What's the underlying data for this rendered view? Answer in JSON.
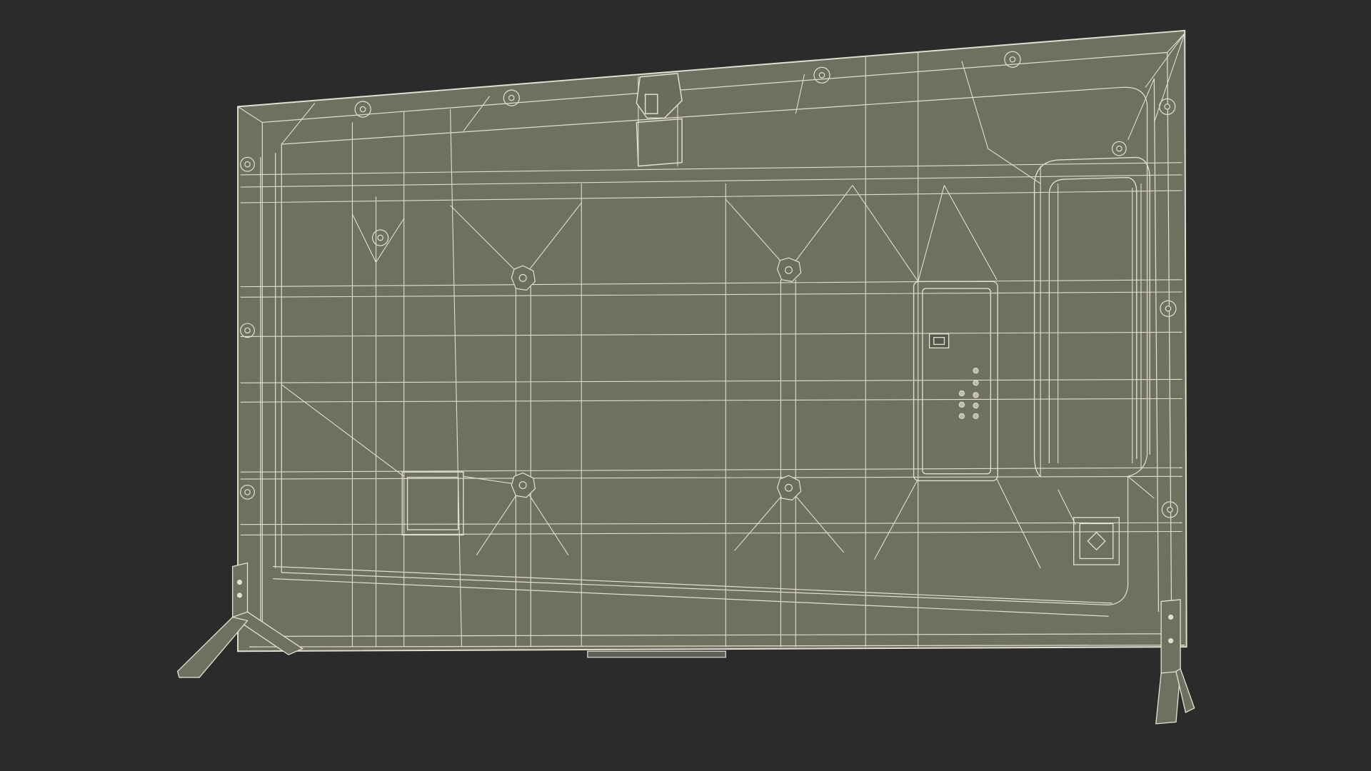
{
  "scene": {
    "subject": "tv-back-wireframe",
    "background_color": "#2b2b2b",
    "panel_fill": "#6e7060",
    "panel_fill_dark": "#63655a",
    "wire_color": "#e3ded0",
    "wire_color_dim": "#cfcab8"
  }
}
